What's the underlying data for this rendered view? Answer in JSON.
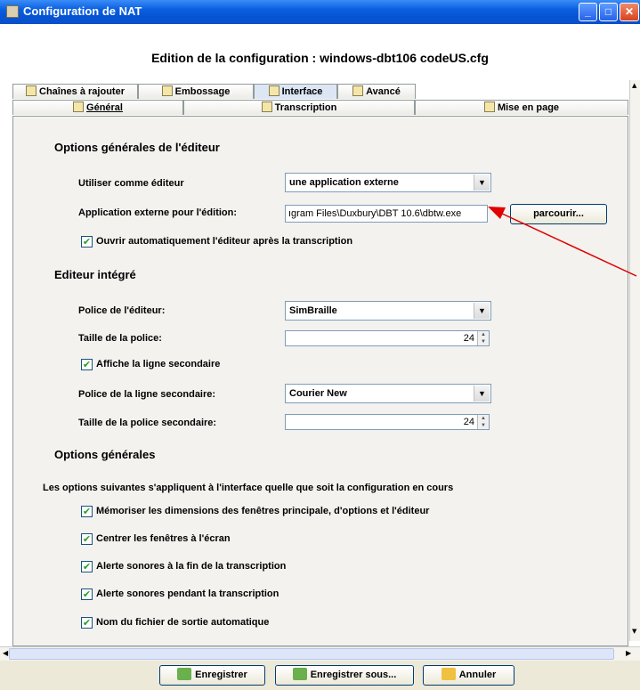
{
  "window": {
    "title": "Configuration de NAT"
  },
  "header": {
    "title": "Edition de la configuration : windows-dbt106 codeUS.cfg"
  },
  "tabs_row1": [
    "Chaînes à rajouter",
    "Embossage",
    "Interface",
    "Avancé"
  ],
  "tabs_row2": [
    "Général",
    "Transcription",
    "Mise en page"
  ],
  "sections": {
    "editor_options": "Options générales de l'éditeur",
    "integrated_editor": "Editeur intégré",
    "general_options": "Options générales"
  },
  "editor": {
    "use_as_editor_label": "Utiliser comme éditeur",
    "use_as_editor_value": "une application externe",
    "external_app_label": "Application externe pour l'édition:",
    "external_app_value": "ıgram Files\\Duxbury\\DBT 10.6\\dbtw.exe",
    "browse_button": "parcourir...",
    "auto_open_label": "Ouvrir automatiquement l'éditeur après la transcription"
  },
  "integrated": {
    "font_label": "Police de l'éditeur:",
    "font_value": "SimBraille",
    "font_size_label": "Taille de la police:",
    "font_size_value": "24",
    "show_secondary_label": "Affiche la ligne secondaire",
    "secondary_font_label": "Police de la ligne secondaire:",
    "secondary_font_value": "Courier New",
    "secondary_size_label": "Taille de la police secondaire:",
    "secondary_size_value": "24"
  },
  "general": {
    "description": "Les options suivantes s'appliquent à l'interface quelle que soit la configuration en cours",
    "options": [
      "Mémoriser les dimensions des fenêtres principale, d'options et l'éditeur",
      "Centrer les fenêtres à l'écran",
      "Alerte sonores à la fin de la transcription",
      "Alerte sonores pendant la transcription",
      "Nom du fichier de sortie automatique"
    ]
  },
  "footer": {
    "save": "Enregistrer",
    "save_as": "Enregistrer sous...",
    "cancel": "Annuler"
  },
  "annotation_color": "#e00000"
}
